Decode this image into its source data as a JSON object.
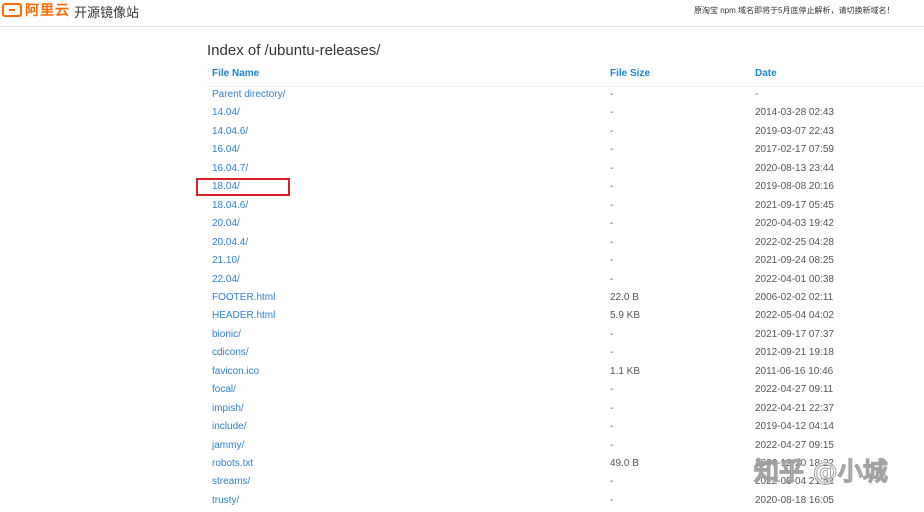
{
  "header": {
    "logo_text": "阿里云",
    "site_title": "开源镜像站",
    "notice": "原淘宝 npm 域名即将于5月底停止解析，请切换新域名！"
  },
  "page": {
    "title": "Index of /ubuntu-releases/"
  },
  "columns": {
    "name": "File Name",
    "size": "File Size",
    "date": "Date"
  },
  "entries": [
    {
      "name": "Parent directory/",
      "size": "-",
      "date": "-"
    },
    {
      "name": "14.04/",
      "size": "-",
      "date": "2014-03-28 02:43"
    },
    {
      "name": "14.04.6/",
      "size": "-",
      "date": "2019-03-07 22:43"
    },
    {
      "name": "16.04/",
      "size": "-",
      "date": "2017-02-17 07:59"
    },
    {
      "name": "16.04.7/",
      "size": "-",
      "date": "2020-08-13 23:44"
    },
    {
      "name": "18.04/",
      "size": "-",
      "date": "2019-08-08 20:16"
    },
    {
      "name": "18.04.6/",
      "size": "-",
      "date": "2021-09-17 05:45"
    },
    {
      "name": "20.04/",
      "size": "-",
      "date": "2020-04-03 19:42"
    },
    {
      "name": "20.04.4/",
      "size": "-",
      "date": "2022-02-25 04:28"
    },
    {
      "name": "21.10/",
      "size": "-",
      "date": "2021-09-24 08:25"
    },
    {
      "name": "22.04/",
      "size": "-",
      "date": "2022-04-01 00:38"
    },
    {
      "name": "FOOTER.html",
      "size": "22.0 B",
      "date": "2006-02-02 02:11"
    },
    {
      "name": "HEADER.html",
      "size": "5.9 KB",
      "date": "2022-05-04 04:02"
    },
    {
      "name": "bionic/",
      "size": "-",
      "date": "2021-09-17 07:37"
    },
    {
      "name": "cdicons/",
      "size": "-",
      "date": "2012-09-21 19:18"
    },
    {
      "name": "favicon.ico",
      "size": "1.1 KB",
      "date": "2011-06-16 10:46"
    },
    {
      "name": "focal/",
      "size": "-",
      "date": "2022-04-27 09:11"
    },
    {
      "name": "impish/",
      "size": "-",
      "date": "2022-04-21 22:37"
    },
    {
      "name": "include/",
      "size": "-",
      "date": "2019-04-12 04:14"
    },
    {
      "name": "jammy/",
      "size": "-",
      "date": "2022-04-27 09:15"
    },
    {
      "name": "robots.txt",
      "size": "49.0 B",
      "date": "2006-12-20 18:22"
    },
    {
      "name": "streams/",
      "size": "-",
      "date": "2022-05-04 21:52"
    },
    {
      "name": "trusty/",
      "size": "-",
      "date": "2020-08-18 16:05"
    }
  ],
  "watermark": "知乎 @小城",
  "colors": {
    "accent": "#ff6a00",
    "link": "#2d7fd0",
    "header_link": "#1a85d0",
    "highlight_box": "#d6202a"
  }
}
